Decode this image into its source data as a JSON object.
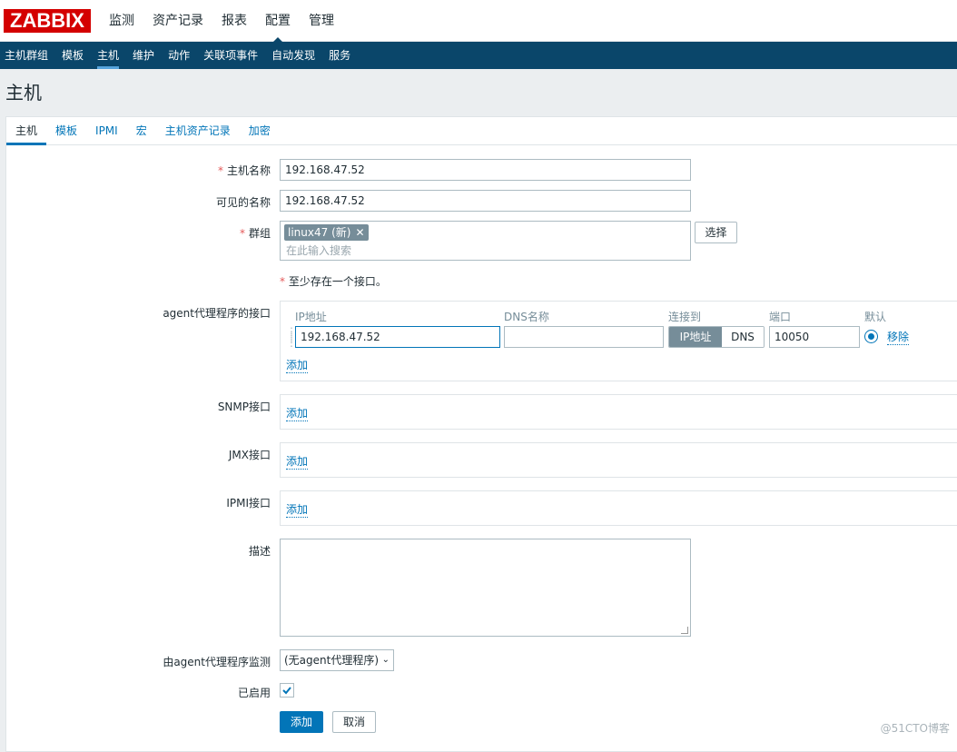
{
  "top_nav": {
    "logo": "ZABBIX",
    "items": [
      "监测",
      "资产记录",
      "报表",
      "配置",
      "管理"
    ],
    "active": "配置"
  },
  "sub_nav": {
    "items": [
      "主机群组",
      "模板",
      "主机",
      "维护",
      "动作",
      "关联项事件",
      "自动发现",
      "服务"
    ],
    "active": "主机"
  },
  "page_title": "主机",
  "tabs": [
    "主机",
    "模板",
    "IPMI",
    "宏",
    "主机资产记录",
    "加密"
  ],
  "form": {
    "host_name": {
      "label": "主机名称",
      "value": "192.168.47.52"
    },
    "visible_name": {
      "label": "可见的名称",
      "value": "192.168.47.52"
    },
    "groups": {
      "label": "群组",
      "tag": "linux47 (新)",
      "placeholder": "在此输入搜索",
      "select_button": "选择"
    },
    "interface_note": "至少存在一个接口。",
    "agent_interfaces": {
      "label": "agent代理程序的接口",
      "col_ip": "IP地址",
      "col_dns": "DNS名称",
      "col_connect": "连接到",
      "col_port": "端口",
      "col_default": "默认",
      "ip": "192.168.47.52",
      "dns": "",
      "connect_ip": "IP地址",
      "connect_dns": "DNS",
      "port": "10050",
      "remove": "移除",
      "add": "添加"
    },
    "snmp": {
      "label": "SNMP接口",
      "add": "添加"
    },
    "jmx": {
      "label": "JMX接口",
      "add": "添加"
    },
    "ipmi": {
      "label": "IPMI接口",
      "add": "添加"
    },
    "description": {
      "label": "描述",
      "value": ""
    },
    "proxy": {
      "label": "由agent代理程序监测",
      "value": "(无agent代理程序)"
    },
    "enabled": {
      "label": "已启用",
      "checked": true
    },
    "buttons": {
      "add": "添加",
      "cancel": "取消"
    }
  },
  "watermark": "@51CTO博客"
}
